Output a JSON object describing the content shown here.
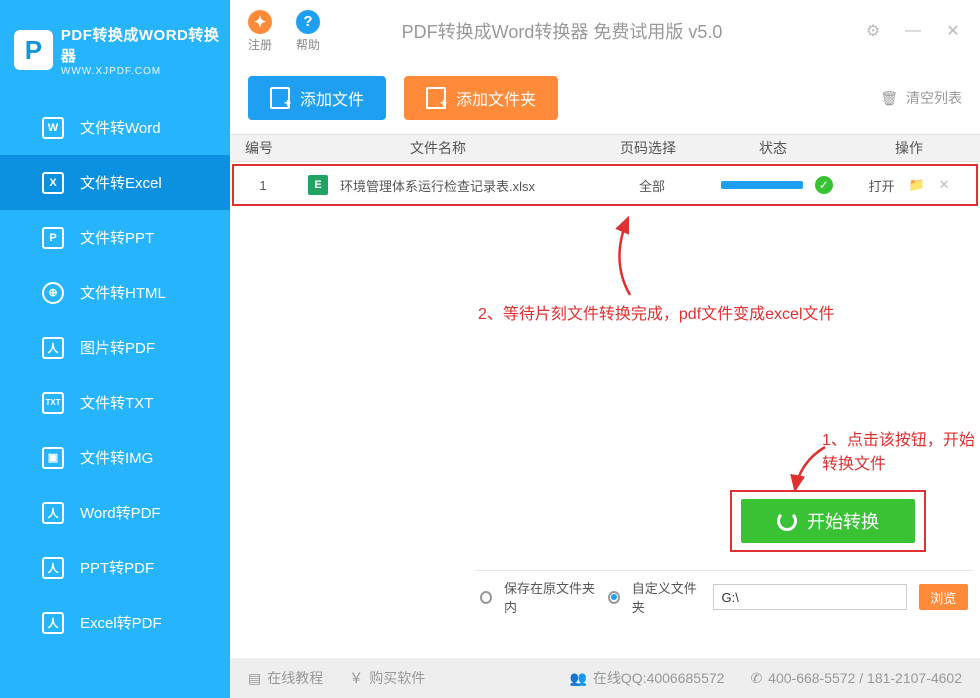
{
  "app": {
    "title": "PDF转换成WORD转换器",
    "subtitle": "WWW.XJPDF.COM",
    "window_title": "PDF转换成Word转换器 免费试用版 v5.0"
  },
  "titlebar": {
    "register": "注册",
    "help": "帮助"
  },
  "nav": [
    {
      "label": "文件转Word",
      "icon": "W"
    },
    {
      "label": "文件转Excel",
      "icon": "X",
      "active": true
    },
    {
      "label": "文件转PPT",
      "icon": "P"
    },
    {
      "label": "文件转HTML",
      "icon": "⊕"
    },
    {
      "label": "图片转PDF",
      "icon": "人"
    },
    {
      "label": "文件转TXT",
      "icon": "TXT"
    },
    {
      "label": "文件转IMG",
      "icon": "▣"
    },
    {
      "label": "Word转PDF",
      "icon": "人"
    },
    {
      "label": "PPT转PDF",
      "icon": "人"
    },
    {
      "label": "Excel转PDF",
      "icon": "人"
    }
  ],
  "toolbar": {
    "add_file": "添加文件",
    "add_folder": "添加文件夹",
    "clear": "清空列表"
  },
  "table": {
    "headers": {
      "num": "编号",
      "name": "文件名称",
      "page": "页码选择",
      "status": "状态",
      "action": "操作"
    },
    "rows": [
      {
        "num": "1",
        "name": "环境管理体系运行检查记录表.xlsx",
        "page": "全部",
        "open": "打开"
      }
    ]
  },
  "annotations": {
    "step2": "2、等待片刻文件转换完成，pdf文件变成excel文件",
    "step1": "1、点击该按钮，开始转换文件"
  },
  "start_button": "开始转换",
  "save": {
    "same_folder": "保存在原文件夹内",
    "custom_folder": "自定义文件夹",
    "path": "G:\\",
    "browse": "浏览"
  },
  "footer": {
    "tutorial": "在线教程",
    "buy": "购买软件",
    "qq": "在线QQ:4006685572",
    "phone": "400-668-5572 / 181-2107-4602"
  }
}
